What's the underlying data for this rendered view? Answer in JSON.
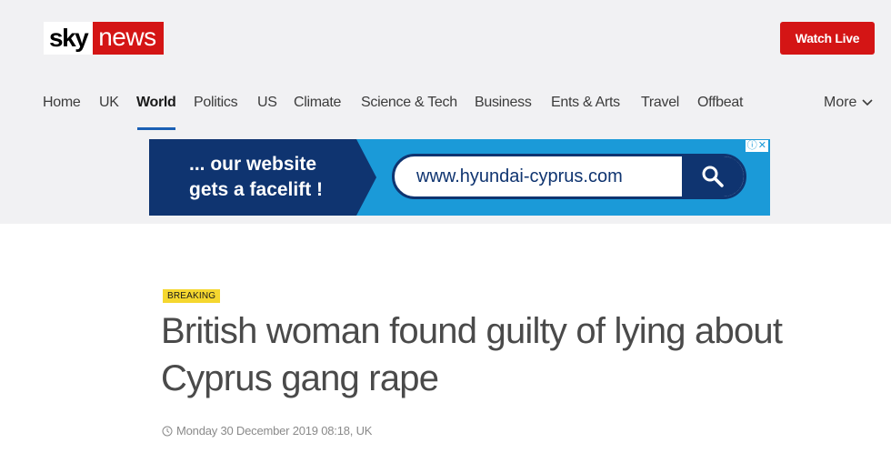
{
  "header": {
    "logo": {
      "sky": "sky",
      "news": "news"
    },
    "watch_live_label": "Watch Live"
  },
  "nav": {
    "items": [
      "Home",
      "UK",
      "World",
      "Politics",
      "US",
      "Climate",
      "Science & Tech",
      "Business",
      "Ents & Arts",
      "Travel",
      "Offbeat"
    ],
    "active": "World",
    "more_label": "More"
  },
  "ad": {
    "tagline_line1": "... our website",
    "tagline_line2": "gets a facelift !",
    "url": "www.hyundai-cyprus.com",
    "icons": [
      "ad-info-icon",
      "ad-close-icon",
      "search-icon"
    ]
  },
  "article": {
    "badge": "BREAKING",
    "headline": "British woman found guilty of lying about Cyprus gang rape",
    "timestamp": "Monday 30 December 2019 08:18, UK"
  },
  "colors": {
    "brand_red": "#d41515",
    "nav_active_underline": "#1a5fb4",
    "breaking_yellow": "#f5d72f",
    "ad_dark_blue": "#0f3470",
    "ad_light_blue": "#1b9ad8"
  }
}
